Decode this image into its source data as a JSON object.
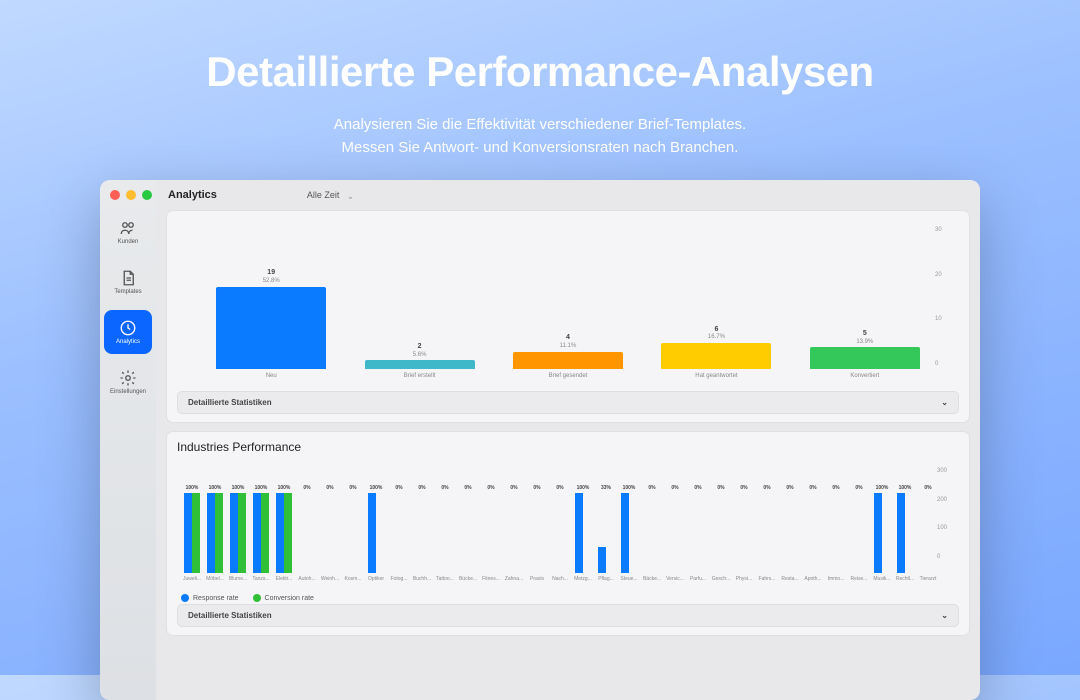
{
  "hero": {
    "title": "Detaillierte Performance-Analysen",
    "sub1": "Analysieren Sie die Effektivität verschiedener Brief-Templates.",
    "sub2": "Messen Sie Antwort- und Konversionsraten nach Branchen."
  },
  "sidebar": {
    "items": [
      {
        "label": "Kunden",
        "icon": "users"
      },
      {
        "label": "Templates",
        "icon": "doc"
      },
      {
        "label": "Analytics",
        "icon": "clock",
        "active": true
      },
      {
        "label": "Einstellungen",
        "icon": "gear"
      }
    ]
  },
  "topbar": {
    "title": "Analytics",
    "time_filter": "Alle Zeit"
  },
  "chart_data": [
    {
      "type": "bar",
      "ylim": [
        0,
        30
      ],
      "yticks": [
        0,
        10,
        20,
        30
      ],
      "series": [
        {
          "category": "Neu",
          "count": 19,
          "pct": "52.8%",
          "color": "#0a7aff"
        },
        {
          "category": "Brief erstellt",
          "count": 2,
          "pct": "5.6%",
          "color": "#3fb8c9"
        },
        {
          "category": "Brief gesendet",
          "count": 4,
          "pct": "11.1%",
          "color": "#ff9500"
        },
        {
          "category": "Hat geantwortet",
          "count": 6,
          "pct": "16.7%",
          "color": "#ffcc00"
        },
        {
          "category": "Konvertiert",
          "count": 5,
          "pct": "13.9%",
          "color": "#34c759"
        }
      ],
      "detail_label": "Detaillierte Statistiken"
    },
    {
      "type": "bar",
      "title": "Industries Performance",
      "ylim": [
        0,
        300
      ],
      "yticks": [
        0,
        100,
        200,
        300
      ],
      "legend": [
        {
          "name": "Response rate",
          "color": "#0a7aff"
        },
        {
          "name": "Conversion rate",
          "color": "#30c037"
        }
      ],
      "categories": [
        "Juweli...",
        "Möbel...",
        "Blume...",
        "Tanzs...",
        "Elektr...",
        "Autoh...",
        "Weinh...",
        "Kosm...",
        "Optiker",
        "Fotog...",
        "Buchh...",
        "Tattoo...",
        "Bücke...",
        "Fitnes...",
        "Zahna...",
        "Praxis",
        "Nach...",
        "Metzg...",
        "Pflag...",
        "Steue...",
        "Bäcke...",
        "Versic...",
        "Parfu...",
        "Gesch...",
        "Physi...",
        "Fahrs...",
        "Resta...",
        "Apoth...",
        "Immo...",
        "Reise...",
        "Musik...",
        "Rechtl...",
        "Tierarzt"
      ],
      "response": [
        100,
        100,
        100,
        100,
        100,
        0,
        0,
        0,
        100,
        0,
        0,
        0,
        0,
        0,
        0,
        0,
        0,
        100,
        33,
        100,
        0,
        0,
        0,
        0,
        0,
        0,
        0,
        0,
        0,
        0,
        100,
        100,
        0
      ],
      "conversion": [
        100,
        100,
        100,
        100,
        100,
        0,
        0,
        0,
        0,
        0,
        0,
        0,
        0,
        0,
        0,
        0,
        0,
        0,
        0,
        0,
        0,
        0,
        0,
        0,
        0,
        0,
        0,
        0,
        0,
        0,
        0,
        0,
        0
      ],
      "detail_label": "Detaillierte Statistiken"
    }
  ]
}
